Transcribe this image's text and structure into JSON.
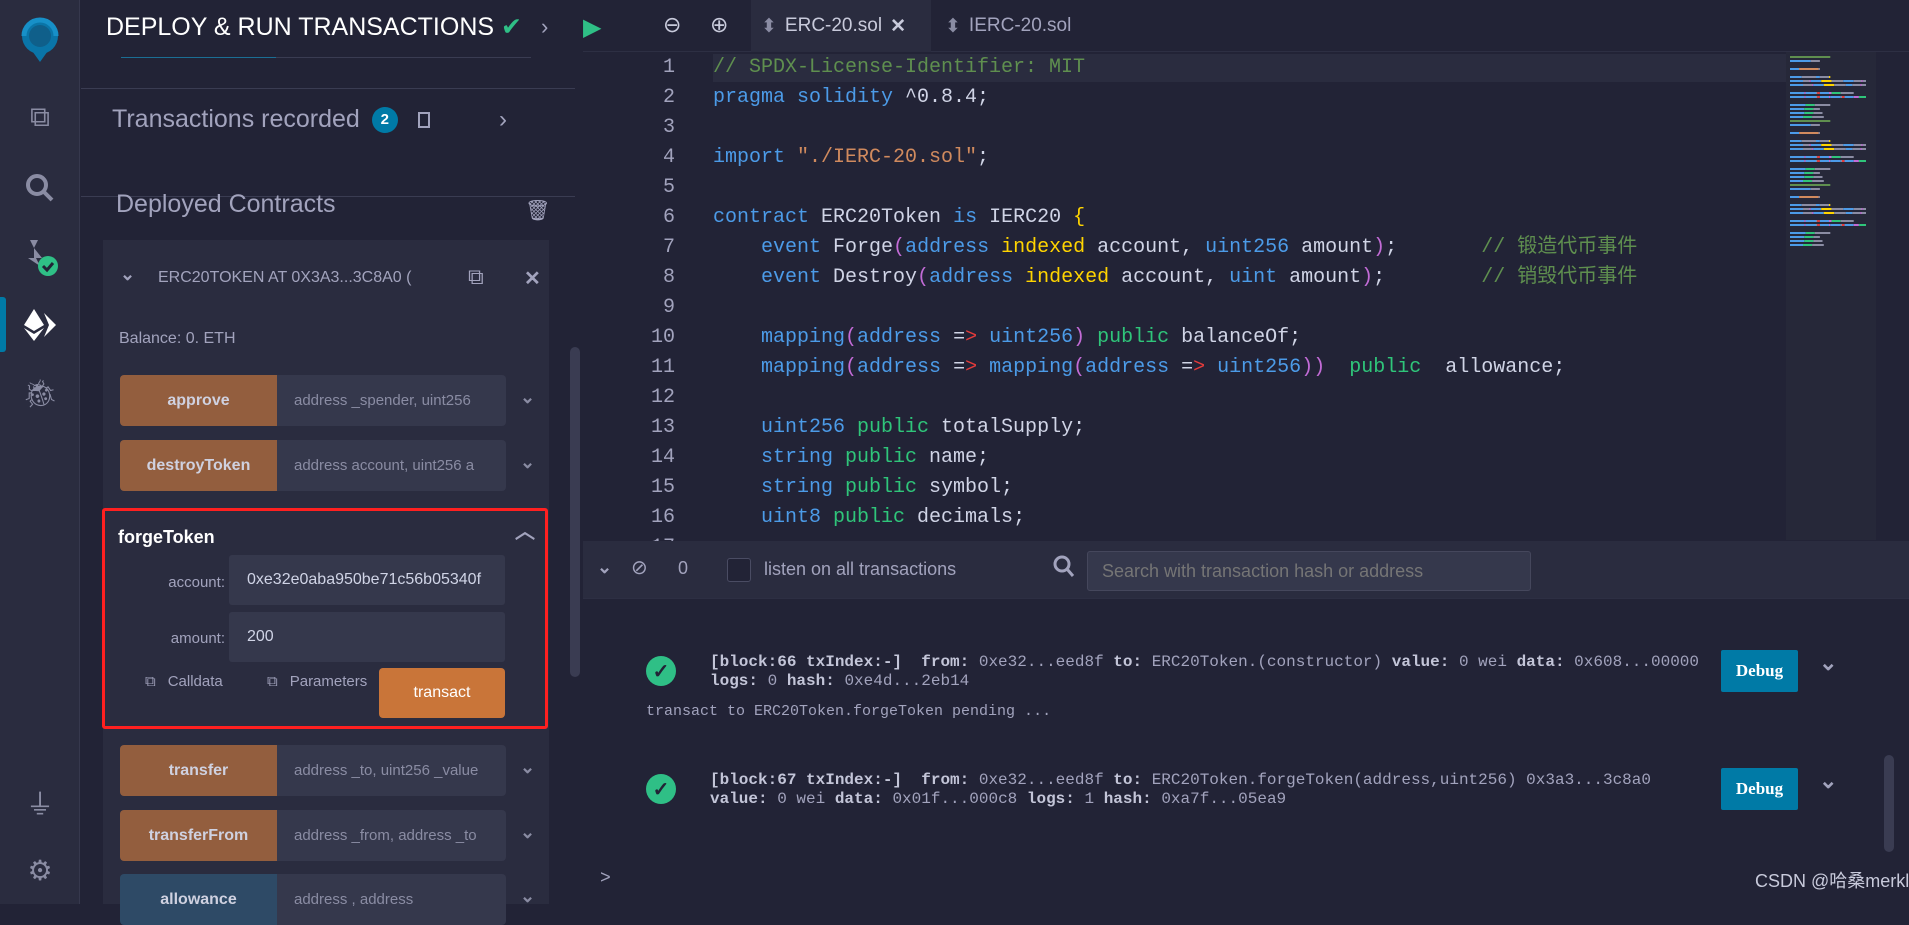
{
  "colors": {
    "accent": "#007aa6",
    "function_button": "#935e3e",
    "transact": "#c97539",
    "highlight_border": "#ff2020",
    "success": "#2fbf86"
  },
  "sidebar": {
    "icons": [
      "remix-logo-icon",
      "file-explorer-icon",
      "search-icon",
      "solidity-compiler-icon",
      "deploy-run-icon",
      "debugger-icon",
      "plugin-manager-icon",
      "settings-icon"
    ],
    "active": "deploy-run-icon"
  },
  "panel": {
    "title": "DEPLOY & RUN TRANSACTIONS",
    "transactions_label": "Transactions recorded",
    "transactions_count": "2",
    "deployed_label": "Deployed Contracts",
    "contract": {
      "name": "ERC20TOKEN AT 0X3A3...3C8A0 (",
      "balance": "Balance: 0. ETH",
      "functions_top": [
        {
          "label": "approve",
          "placeholder": "address _spender, uint256"
        },
        {
          "label": "destroyToken",
          "placeholder": "address account, uint256 a"
        }
      ],
      "expanded": {
        "label": "forgeToken",
        "fields": [
          {
            "label": "account:",
            "value": "0xe32e0aba950be71c56b05340f"
          },
          {
            "label": "amount:",
            "value": "200"
          }
        ],
        "calldata": "Calldata",
        "parameters": "Parameters",
        "transact": "transact"
      },
      "functions_bottom": [
        {
          "label": "transfer",
          "placeholder": "address _to, uint256 _value",
          "type": "transact"
        },
        {
          "label": "transferFrom",
          "placeholder": "address _from, address _to",
          "type": "transact"
        },
        {
          "label": "allowance",
          "placeholder": "address , address",
          "type": "call"
        }
      ]
    }
  },
  "editor": {
    "tabs": [
      {
        "label": "ERC-20.sol",
        "active": true
      },
      {
        "label": "IERC-20.sol",
        "active": false
      }
    ],
    "lines": [
      [
        [
          "// SPDX-License-Identifier: MIT",
          "c"
        ]
      ],
      [
        [
          "pragma solidity ",
          "k"
        ],
        [
          "^0.8.4;",
          "w"
        ]
      ],
      [],
      [
        [
          "import ",
          "k"
        ],
        [
          "\"./IERC-20.sol\"",
          "s"
        ],
        [
          ";",
          "w"
        ]
      ],
      [],
      [
        [
          "contract ",
          "k"
        ],
        [
          "ERC20Token ",
          "w"
        ],
        [
          "is ",
          "k"
        ],
        [
          "IERC20 ",
          "w"
        ],
        [
          "{",
          "b"
        ]
      ],
      [
        [
          "    event ",
          "k"
        ],
        [
          "Forge",
          "w"
        ],
        [
          "(",
          "p"
        ],
        [
          "address ",
          "k"
        ],
        [
          "indexed ",
          "y"
        ],
        [
          "account, ",
          "w"
        ],
        [
          "uint256 ",
          "k"
        ],
        [
          "amount",
          "w"
        ],
        [
          ")",
          "p"
        ],
        [
          ";       ",
          "w"
        ],
        [
          "// 锻造代币事件",
          "c"
        ]
      ],
      [
        [
          "    event ",
          "k"
        ],
        [
          "Destroy",
          "w"
        ],
        [
          "(",
          "p"
        ],
        [
          "address ",
          "k"
        ],
        [
          "indexed ",
          "y"
        ],
        [
          "account, ",
          "w"
        ],
        [
          "uint ",
          "k"
        ],
        [
          "amount",
          "w"
        ],
        [
          ")",
          "p"
        ],
        [
          ";        ",
          "w"
        ],
        [
          "// 销毁代币事件",
          "c"
        ]
      ],
      [],
      [
        [
          "    mapping",
          "k"
        ],
        [
          "(",
          "p"
        ],
        [
          "address ",
          "k"
        ],
        [
          "=",
          "w"
        ],
        [
          "> ",
          "r"
        ],
        [
          "uint256",
          "k"
        ],
        [
          ") ",
          "p"
        ],
        [
          "public ",
          "g"
        ],
        [
          "balanceOf;",
          "w"
        ]
      ],
      [
        [
          "    mapping",
          "k"
        ],
        [
          "(",
          "p"
        ],
        [
          "address ",
          "k"
        ],
        [
          "=",
          "w"
        ],
        [
          "> ",
          "r"
        ],
        [
          "mapping",
          "k"
        ],
        [
          "(",
          "p"
        ],
        [
          "address ",
          "k"
        ],
        [
          "=",
          "w"
        ],
        [
          "> ",
          "r"
        ],
        [
          "uint256",
          "k"
        ],
        [
          "))  ",
          "p"
        ],
        [
          "public  ",
          "g"
        ],
        [
          "allowance;",
          "w"
        ]
      ],
      [],
      [
        [
          "    uint256 ",
          "k"
        ],
        [
          "public ",
          "g"
        ],
        [
          "totalSupply;",
          "w"
        ]
      ],
      [
        [
          "    string ",
          "k"
        ],
        [
          "public ",
          "g"
        ],
        [
          "name;",
          "w"
        ]
      ],
      [
        [
          "    string ",
          "k"
        ],
        [
          "public ",
          "g"
        ],
        [
          "symbol;",
          "w"
        ]
      ],
      [
        [
          "    uint8 ",
          "k"
        ],
        [
          "public ",
          "g"
        ],
        [
          "decimals;",
          "w"
        ]
      ]
    ]
  },
  "terminal": {
    "pending_count": "0",
    "listen_label": "listen on all transactions",
    "search_placeholder": "Search with transaction hash or address",
    "entries": [
      {
        "lines": [
          [
            [
              "[block:66 txIndex:-]",
              1
            ],
            [
              "  ",
              0
            ],
            [
              "from:",
              1
            ],
            [
              " 0xe32...eed8f ",
              0
            ],
            [
              "to:",
              1
            ],
            [
              " ERC20Token.(constructor) ",
              0
            ],
            [
              "value:",
              1
            ],
            [
              " 0 wei ",
              0
            ],
            [
              "data:",
              1
            ],
            [
              " 0x608...00000",
              0
            ]
          ],
          [
            [
              "logs:",
              1
            ],
            [
              " 0 ",
              0
            ],
            [
              "hash:",
              1
            ],
            [
              " 0xe4d...2eb14",
              0
            ]
          ]
        ],
        "debug": "Debug"
      },
      {
        "lines": [
          [
            [
              "[block:67 txIndex:-]",
              1
            ],
            [
              "  ",
              0
            ],
            [
              "from:",
              1
            ],
            [
              " 0xe32...eed8f ",
              0
            ],
            [
              "to:",
              1
            ],
            [
              " ERC20Token.forgeToken(address,uint256) 0x3a3...3c8a0",
              0
            ]
          ],
          [
            [
              "value:",
              1
            ],
            [
              " 0 wei ",
              0
            ],
            [
              "data:",
              1
            ],
            [
              " 0x01f...000c8 ",
              0
            ],
            [
              "logs:",
              1
            ],
            [
              " 1 ",
              0
            ],
            [
              "hash:",
              1
            ],
            [
              " 0xa7f...05ea9",
              0
            ]
          ]
        ],
        "debug": "Debug"
      }
    ],
    "pending_message": "transact to ERC20Token.forgeToken pending ...",
    "prompt": ">"
  },
  "watermark": "CSDN @哈桑merkletree"
}
